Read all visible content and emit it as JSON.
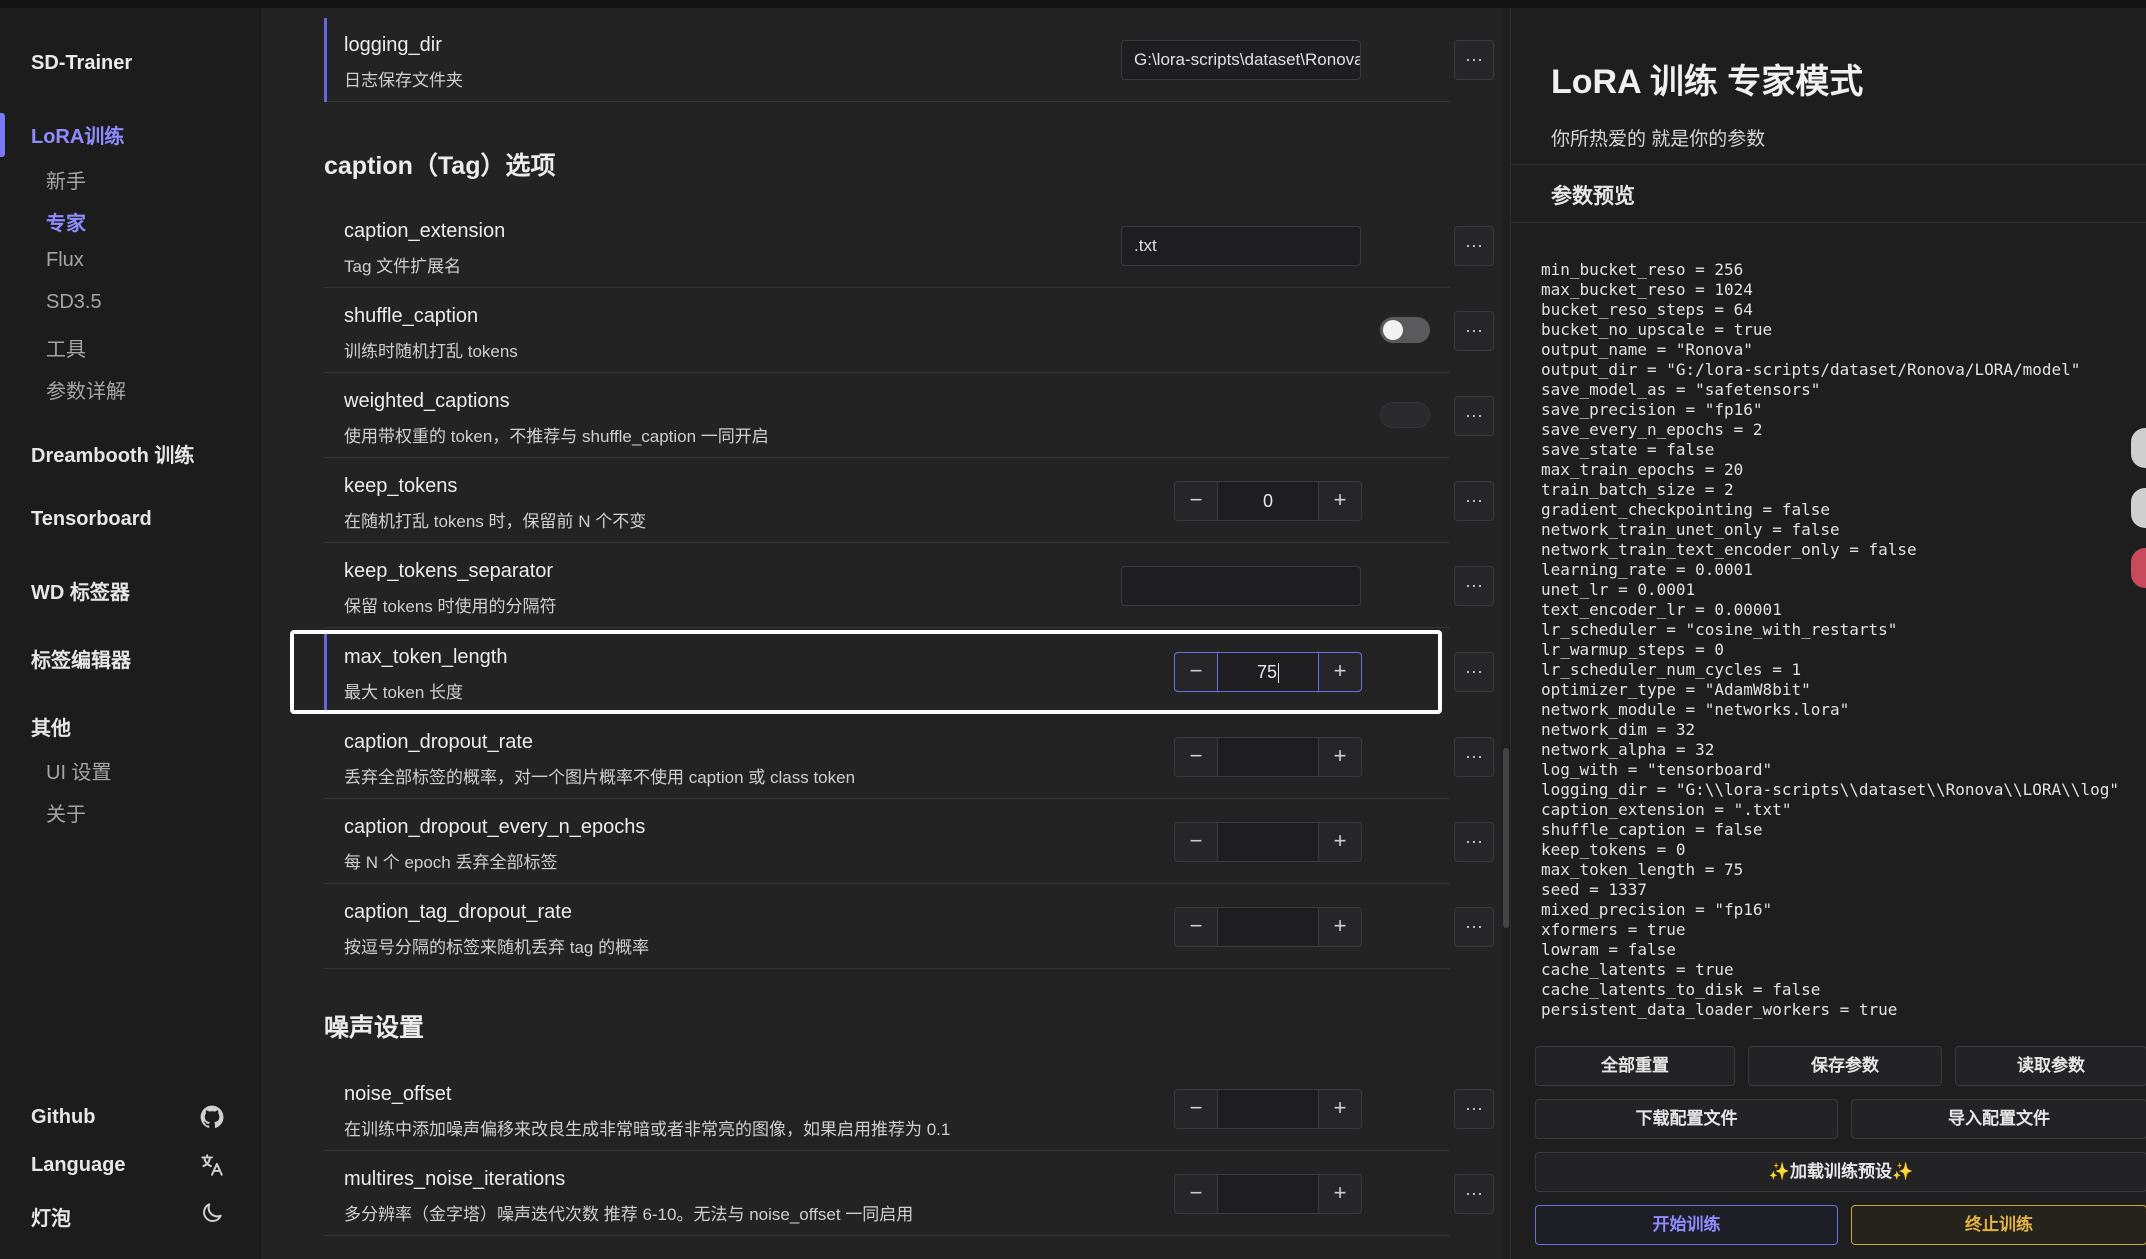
{
  "sidebar": {
    "brand": "SD-Trainer",
    "lora": "LoRA训练",
    "lora_sub": [
      "新手",
      "专家",
      "Flux",
      "SD3.5",
      "工具",
      "参数详解"
    ],
    "dreambooth": "Dreambooth 训练",
    "tensorboard": "Tensorboard",
    "wd": "WD 标签器",
    "tag_editor": "标签编辑器",
    "other": "其他",
    "other_sub": [
      "UI 设置",
      "关于"
    ],
    "github": "Github",
    "language": "Language",
    "theme": "灯泡",
    "icons": {
      "github": "github-icon",
      "language": "translate-icon",
      "theme": "moon-icon"
    }
  },
  "main": {
    "logging": {
      "name": "logging_dir",
      "desc": "日志保存文件夹",
      "value": "G:\\lora-scripts\\dataset\\Ronova\\LORA\\log"
    },
    "caption_section": "caption（Tag）选项",
    "caption_extension": {
      "name": "caption_extension",
      "desc": "Tag 文件扩展名",
      "value": ".txt"
    },
    "shuffle_caption": {
      "name": "shuffle_caption",
      "desc": "训练时随机打乱 tokens",
      "value": false
    },
    "weighted_captions": {
      "name": "weighted_captions",
      "desc": "使用带权重的 token，不推荐与 shuffle_caption 一同开启"
    },
    "keep_tokens": {
      "name": "keep_tokens",
      "desc": "在随机打乱 tokens 时，保留前 N 个不变",
      "value": "0"
    },
    "keep_tokens_separator": {
      "name": "keep_tokens_separator",
      "desc": "保留 tokens 时使用的分隔符",
      "value": ""
    },
    "max_token_length": {
      "name": "max_token_length",
      "desc": "最大 token 长度",
      "value": "75"
    },
    "caption_dropout_rate": {
      "name": "caption_dropout_rate",
      "desc": "丢弃全部标签的概率，对一个图片概率不使用 caption 或 class token",
      "value": ""
    },
    "caption_dropout_every_n_epochs": {
      "name": "caption_dropout_every_n_epochs",
      "desc": "每 N 个 epoch 丢弃全部标签",
      "value": ""
    },
    "caption_tag_dropout_rate": {
      "name": "caption_tag_dropout_rate",
      "desc": "按逗号分隔的标签来随机丢弃 tag 的概率",
      "value": ""
    },
    "noise_section": "噪声设置",
    "noise_offset": {
      "name": "noise_offset",
      "desc": "在训练中添加噪声偏移来改良生成非常暗或者非常亮的图像，如果启用推荐为 0.1",
      "value": ""
    },
    "multires_noise_iterations": {
      "name": "multires_noise_iterations",
      "desc": "多分辨率（金字塔）噪声迭代次数 推荐 6-10。无法与 noise_offset 一同启用",
      "value": ""
    },
    "more_label": "···",
    "minus": "−",
    "plus": "+"
  },
  "panel": {
    "title": "LoRA 训练 专家模式",
    "subtitle": "你所热爱的 就是你的参数",
    "preview": "参数预览",
    "lines": [
      "min_bucket_reso = 256",
      "max_bucket_reso = 1024",
      "bucket_reso_steps = 64",
      "bucket_no_upscale = true",
      "output_name = \"Ronova\"",
      "output_dir = \"G:/lora-scripts/dataset/Ronova/LORA/model\"",
      "save_model_as = \"safetensors\"",
      "save_precision = \"fp16\"",
      "save_every_n_epochs = 2",
      "save_state = false",
      "max_train_epochs = 20",
      "train_batch_size = 2",
      "gradient_checkpointing = false",
      "network_train_unet_only = false",
      "network_train_text_encoder_only = false",
      "learning_rate = 0.0001",
      "unet_lr = 0.0001",
      "text_encoder_lr = 0.00001",
      "lr_scheduler = \"cosine_with_restarts\"",
      "lr_warmup_steps = 0",
      "lr_scheduler_num_cycles = 1",
      "optimizer_type = \"AdamW8bit\"",
      "network_module = \"networks.lora\"",
      "network_dim = 32",
      "network_alpha = 32",
      "log_with = \"tensorboard\"",
      "logging_dir = \"G:\\\\lora-scripts\\\\dataset\\\\Ronova\\\\LORA\\\\log\"",
      "caption_extension = \".txt\"",
      "shuffle_caption = false",
      "keep_tokens = 0",
      "max_token_length = 75",
      "seed = 1337",
      "mixed_precision = \"fp16\"",
      "xformers = true",
      "lowram = false",
      "cache_latents = true",
      "cache_latents_to_disk = false",
      "persistent_data_loader_workers = true"
    ],
    "buttons": {
      "reset": "全部重置",
      "save": "保存参数",
      "load": "读取参数",
      "download": "下载配置文件",
      "import": "导入配置文件",
      "preset": "✨加载训练预设✨",
      "start": "开始训练",
      "stop": "终止训练"
    }
  },
  "colors": {
    "accent": "#8f8cff",
    "stop": "#e3b445",
    "bg": "#232324"
  }
}
